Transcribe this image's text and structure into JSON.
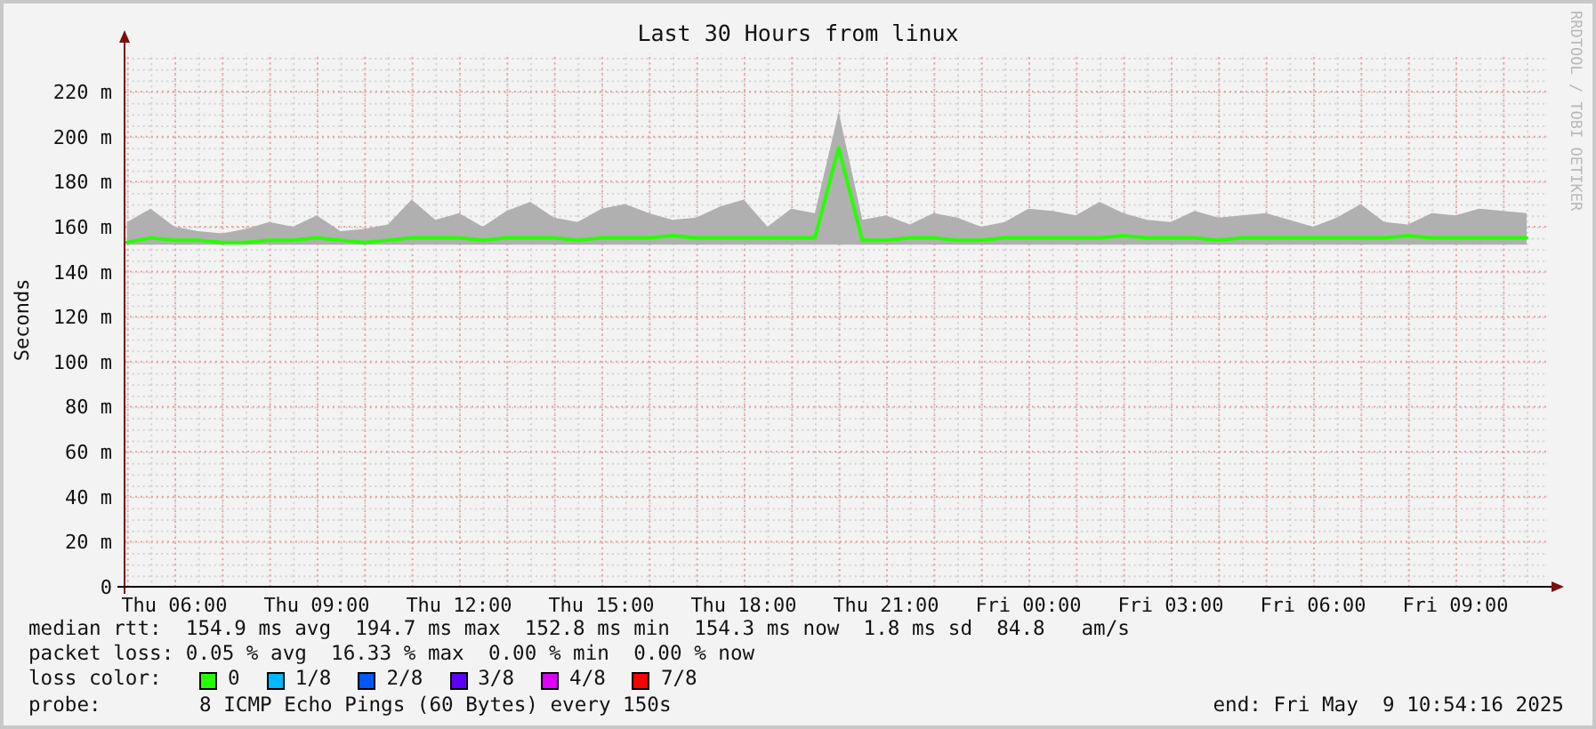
{
  "title": "Last 30 Hours from linux",
  "credit": "RRDTOOL / TOBI OETIKER",
  "chart_data": {
    "type": "line",
    "grid": true,
    "ylabel": "Seconds",
    "ylim": [
      0,
      237
    ],
    "yticks": [
      {
        "value": 0,
        "label": "0"
      },
      {
        "value": 20,
        "label": "20 m"
      },
      {
        "value": 40,
        "label": "40 m"
      },
      {
        "value": 60,
        "label": "60 m"
      },
      {
        "value": 80,
        "label": "80 m"
      },
      {
        "value": 100,
        "label": "100 m"
      },
      {
        "value": 120,
        "label": "120 m"
      },
      {
        "value": 140,
        "label": "140 m"
      },
      {
        "value": 160,
        "label": "160 m"
      },
      {
        "value": 180,
        "label": "180 m"
      },
      {
        "value": 200,
        "label": "200 m"
      },
      {
        "value": 220,
        "label": "220 m"
      }
    ],
    "categories": [
      null,
      null,
      "Thu 06:00",
      null,
      null,
      null,
      null,
      null,
      "Thu 09:00",
      null,
      null,
      null,
      null,
      null,
      "Thu 12:00",
      null,
      null,
      null,
      null,
      null,
      "Thu 15:00",
      null,
      null,
      null,
      null,
      null,
      "Thu 18:00",
      null,
      null,
      null,
      null,
      null,
      "Thu 21:00",
      null,
      null,
      null,
      null,
      null,
      "Fri 00:00",
      null,
      null,
      null,
      null,
      null,
      "Fri 03:00",
      null,
      null,
      null,
      null,
      null,
      "Fri 06:00",
      null,
      null,
      null,
      null,
      null,
      "Fri 09:00",
      null,
      null,
      null
    ],
    "series": [
      {
        "type": "area",
        "color": "#b0b0b0",
        "values": [
          162,
          168,
          160,
          158,
          157,
          159,
          162,
          160,
          165,
          158,
          159,
          161,
          172,
          163,
          166,
          160,
          167,
          171,
          164,
          162,
          168,
          170,
          166,
          163,
          164,
          169,
          172,
          160,
          168,
          166,
          211,
          163,
          165,
          161,
          166,
          164,
          160,
          162,
          168,
          167,
          165,
          171,
          166,
          163,
          162,
          167,
          164,
          165,
          166,
          163,
          160,
          164,
          170,
          162,
          161,
          166,
          165,
          168,
          167,
          166
        ]
      },
      {
        "type": "line",
        "color": "#26ff00",
        "values": [
          153,
          155,
          154,
          154,
          153,
          153,
          154,
          154,
          155,
          154,
          153,
          154,
          155,
          155,
          155,
          154,
          155,
          155,
          155,
          154,
          155,
          155,
          155,
          156,
          155,
          155,
          155,
          155,
          155,
          155,
          195,
          154,
          154,
          155,
          155,
          154,
          154,
          155,
          155,
          155,
          155,
          155,
          156,
          155,
          155,
          155,
          154,
          155,
          155,
          155,
          155,
          155,
          155,
          155,
          156,
          155,
          155,
          155,
          155,
          155
        ]
      }
    ]
  },
  "stats": [
    {
      "text": "median rtt:  154.9 ms avg  194.7 ms max  152.8 ms min  154.3 ms now  1.8 ms sd  84.8   am/s"
    },
    {
      "text": "packet loss: 0.05 % avg  16.33 % max  0.00 % min  0.00 % now"
    }
  ],
  "loss_color": {
    "label": "loss color:",
    "items": [
      {
        "label": "0",
        "color": "#26ff00"
      },
      {
        "label": "1/8",
        "color": "#00b8ff"
      },
      {
        "label": "2/8",
        "color": "#0059ff"
      },
      {
        "label": "3/8",
        "color": "#5e00ff"
      },
      {
        "label": "4/8",
        "color": "#dd00ff"
      },
      {
        "label": "7/8",
        "color": "#ff0000"
      }
    ]
  },
  "probe": {
    "label": "probe:",
    "text": "8 ICMP Echo Pings (60 Bytes) every 150s"
  },
  "end": "end: Fri May  9 10:54:16 2025"
}
